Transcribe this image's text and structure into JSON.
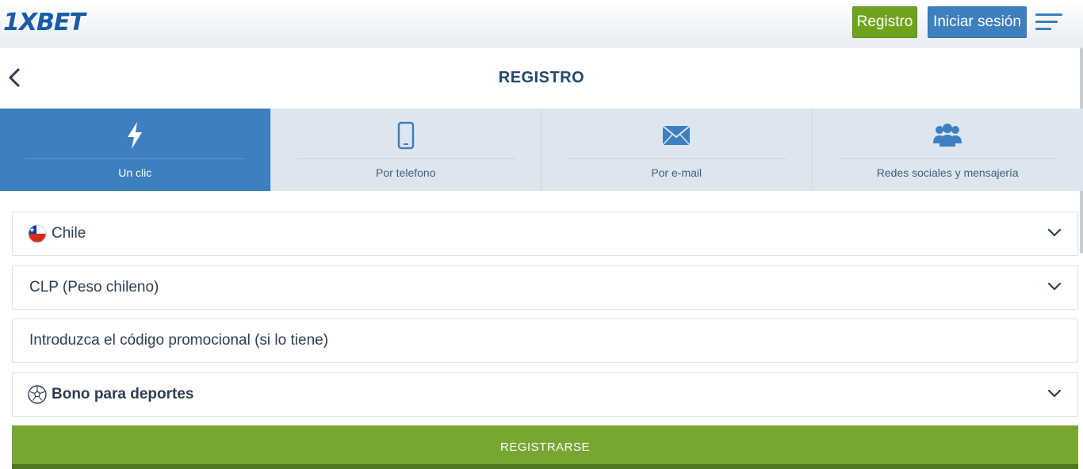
{
  "header": {
    "logo_text": "1XBET",
    "register_label": "Registro",
    "login_label": "Iniciar sesión"
  },
  "page": {
    "title": "REGISTRO"
  },
  "tabs": [
    {
      "label": "Un clic",
      "icon": "lightning-icon",
      "active": true
    },
    {
      "label": "Por telefono",
      "icon": "phone-icon",
      "active": false
    },
    {
      "label": "Por e-mail",
      "icon": "envelope-icon",
      "active": false
    },
    {
      "label": "Redes sociales y mensajería",
      "icon": "people-icon",
      "active": false
    }
  ],
  "form": {
    "country": "Chile",
    "currency": "CLP (Peso chileno)",
    "promo_placeholder": "Introduzca el código promocional (si lo tiene)",
    "bonus": "Bono para deportes",
    "submit_label": "REGISTRARSE"
  },
  "colors": {
    "brand_blue": "#3d7fbf",
    "brand_green": "#77a632",
    "heading": "#244a6b"
  }
}
